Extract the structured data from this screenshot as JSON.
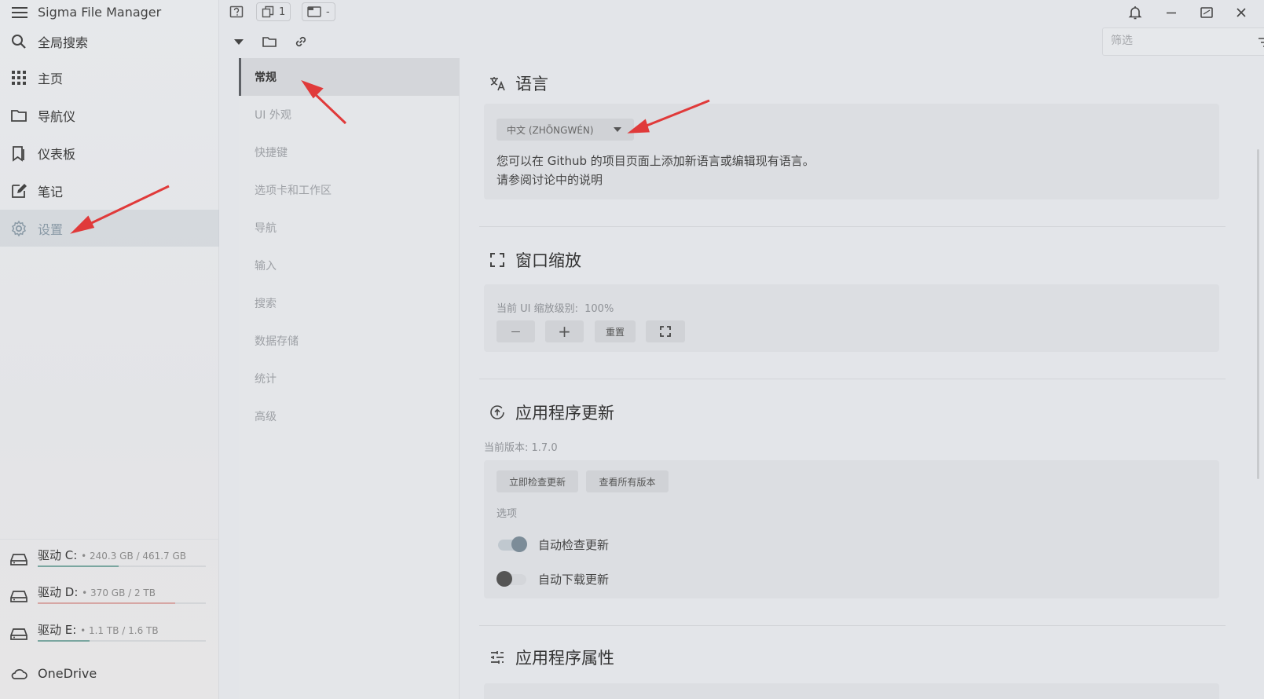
{
  "app": {
    "title": "Sigma File Manager"
  },
  "sidebar": {
    "items": [
      {
        "label": "全局搜索",
        "icon": "search-icon"
      },
      {
        "label": "主页",
        "icon": "grid-icon"
      },
      {
        "label": "导航仪",
        "icon": "folder-icon"
      },
      {
        "label": "仪表板",
        "icon": "bookmark-icon"
      },
      {
        "label": "笔记",
        "icon": "note-edit-icon"
      },
      {
        "label": "设置",
        "icon": "gear-icon",
        "active": true
      }
    ],
    "drives": [
      {
        "name": "驱动 C:",
        "size": "• 240.3 GB / 461.7 GB",
        "used_fraction": 0.48,
        "color": "#7aa6a0"
      },
      {
        "name": "驱动 D:",
        "size": "• 370 GB / 2 TB",
        "used_fraction": 0.82,
        "color": "#d6a6a4"
      },
      {
        "name": "驱动 E:",
        "size": "• 1.1 TB / 1.6 TB",
        "used_fraction": 0.31,
        "color": "#7aa6a0"
      }
    ],
    "cloud": {
      "label": "OneDrive",
      "icon": "cloud-icon"
    }
  },
  "topbar": {
    "tab_count": "1",
    "workspace": "-"
  },
  "toolbar": {
    "filter_placeholder": "筛选"
  },
  "settings_nav": {
    "items": [
      {
        "label": "常规",
        "active": true
      },
      {
        "label": "UI 外观"
      },
      {
        "label": "快捷键"
      },
      {
        "label": "选项卡和工作区"
      },
      {
        "label": "导航"
      },
      {
        "label": "输入"
      },
      {
        "label": "搜索"
      },
      {
        "label": "数据存储"
      },
      {
        "label": "统计"
      },
      {
        "label": "高级"
      }
    ]
  },
  "language": {
    "title": "语言",
    "selected": "中文 (ZHŌNGWÉN)",
    "desc1": "您可以在 Github 的项目页面上添加新语言或编辑现有语言。",
    "desc2": "请参阅讨论中的说明"
  },
  "zoom": {
    "title": "窗口缩放",
    "level_label": "当前 UI 缩放级别:",
    "level_value": "100%",
    "minus": "—",
    "plus": "+",
    "reset": "重置"
  },
  "updates": {
    "title": "应用程序更新",
    "version": "当前版本: 1.7.0",
    "check_now": "立即检查更新",
    "all_versions": "查看所有版本",
    "options_label": "选项",
    "auto_check": {
      "label": "自动检查更新",
      "on": true
    },
    "auto_download": {
      "label": "自动下载更新",
      "on": false
    }
  },
  "properties": {
    "title": "应用程序属性"
  },
  "colors": {
    "arrow": "#e03a3a",
    "toggle_on": "#7c8c98",
    "toggle_off": "#555555"
  }
}
